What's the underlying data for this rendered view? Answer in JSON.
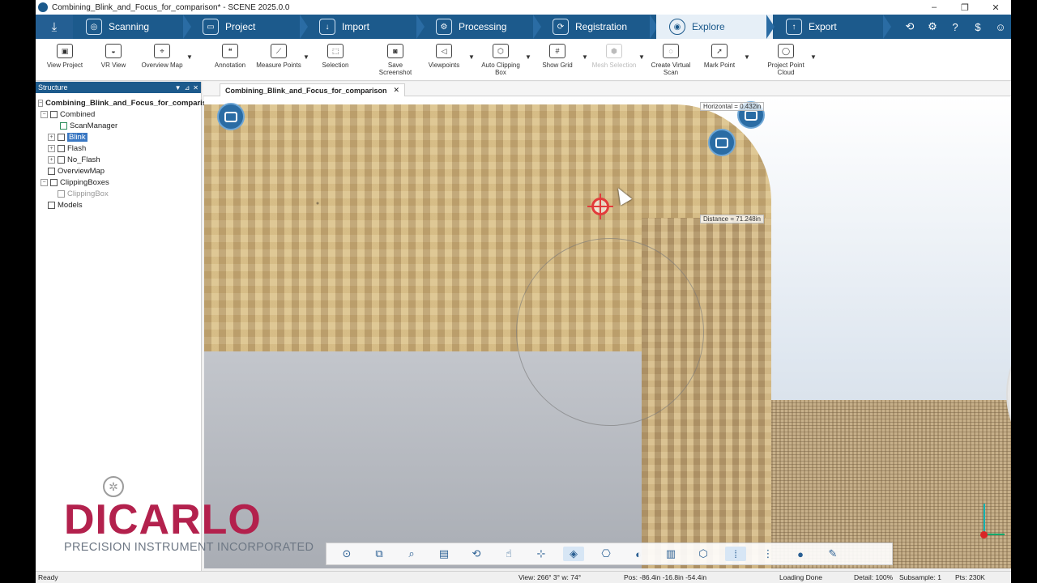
{
  "window": {
    "title": "Combining_Blink_and_Focus_for_comparison* - SCENE 2025.0.0",
    "controls": [
      "–",
      "❐",
      "✕"
    ]
  },
  "workflow": {
    "steps": [
      {
        "label": "Scanning",
        "icon": "scanner-icon"
      },
      {
        "label": "Project",
        "icon": "folder-icon"
      },
      {
        "label": "Import",
        "icon": "import-icon"
      },
      {
        "label": "Processing",
        "icon": "processing-icon"
      },
      {
        "label": "Registration",
        "icon": "registration-icon"
      },
      {
        "label": "Explore",
        "icon": "explore-icon",
        "active": true
      },
      {
        "label": "Export",
        "icon": "export-icon"
      }
    ]
  },
  "toolbar": {
    "view_project": "View Project",
    "vr_view": "VR View",
    "overview_map": "Overview Map",
    "annotation": "Annotation",
    "measure_points": "Measure Points",
    "selection": "Selection",
    "save_screenshot": "Save Screenshot",
    "viewpoints": "Viewpoints",
    "auto_clipping_box": "Auto Clipping Box",
    "show_grid": "Show Grid",
    "mesh_selection": "Mesh Selection",
    "create_virtual_scan": "Create Virtual Scan",
    "mark_point": "Mark Point",
    "project_point_cloud": "Project Point Cloud"
  },
  "structure": {
    "title": "Structure",
    "items": [
      {
        "label": "Combining_Blink_and_Focus_for_comparison"
      },
      {
        "label": "Combined"
      },
      {
        "label": "ScanManager"
      },
      {
        "label": "Blink",
        "selected": true
      },
      {
        "label": "Flash"
      },
      {
        "label": "No_Flash"
      },
      {
        "label": "OverviewMap"
      },
      {
        "label": "ClippingBoxes"
      },
      {
        "label": "ClippingBox",
        "dimmed": true
      },
      {
        "label": "Models"
      }
    ]
  },
  "document_tab": {
    "label": "Combining_Blink_and_Focus_for_comparison"
  },
  "viewport": {
    "horizontal_label": "Horizontal = 0.432in",
    "distance_label": "Distance = 71.248in"
  },
  "brand": {
    "name": "DICARLO",
    "tagline": "PRECISION INSTRUMENT INCORPORATED"
  },
  "statusbar": {
    "state": "Ready",
    "view": "View: 266° 3° w: 74°",
    "pos": "Pos: -86.4in -16.8in -54.4in",
    "loading": "Loading Done",
    "detail": "Detail: 100%",
    "subsample": "Subsample: 1",
    "pts": "Pts: 230K"
  },
  "colors": {
    "ribbon": "#1c5a8c",
    "selection": "#3a78c3",
    "brand_red": "#b3214d",
    "target_red": "#e23b3b"
  }
}
